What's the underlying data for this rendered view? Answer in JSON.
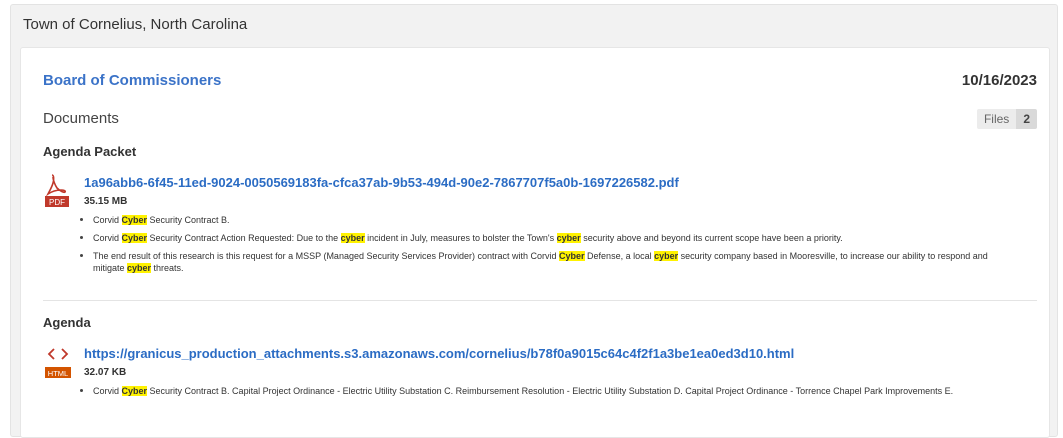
{
  "header": {
    "title": "Town of Cornelius, North Carolina"
  },
  "meeting": {
    "body": "Board of Commissioners",
    "date": "10/16/2023",
    "section_title": "Documents",
    "files_label": "Files",
    "files_count": "2"
  },
  "documents": [
    {
      "group_title": "Agenda Packet",
      "icon": "pdf-icon",
      "icon_label": "PDF",
      "filename": "1a96abb6-6f45-11ed-9024-0050569183fa-cfca37ab-9b53-494d-90e2-7867707f5a0b-1697226582.pdf",
      "size": "35.15 MB",
      "snippets": [
        [
          "Corvid ",
          "Cyber",
          " Security Contract B."
        ],
        [
          "Corvid ",
          "Cyber",
          " Security Contract Action Requested: Due to the ",
          "cyber",
          " incident in July, measures to bolster the Town's ",
          "cyber",
          " security above and beyond its current scope have been a priority."
        ],
        [
          "The end result of this research is this request for a MSSP (Managed Security Services Provider) contract with Corvid ",
          "Cyber",
          " Defense, a local ",
          "cyber",
          " security company based in Mooresville, to increase our ability to respond and mitigate ",
          "cyber",
          " threats."
        ]
      ]
    },
    {
      "group_title": "Agenda",
      "icon": "html-icon",
      "icon_label": "HTML",
      "filename": "https://granicus_production_attachments.s3.amazonaws.com/cornelius/b78f0a9015c64c4f2f1a3be1ea0ed3d10.html",
      "size": "32.07 KB",
      "snippets": [
        [
          "Corvid ",
          "Cyber",
          " Security Contract B. Capital Project Ordinance - Electric Utility Substation C. Reimbursement Resolution - Electric Utility Substation D. Capital Project Ordinance - Torrence Chapel Park Improvements E."
        ]
      ]
    }
  ],
  "colors": {
    "link": "#2b6cc4",
    "highlight": "#fff200",
    "icon_red": "#c0392b",
    "html_orange": "#d35400"
  }
}
